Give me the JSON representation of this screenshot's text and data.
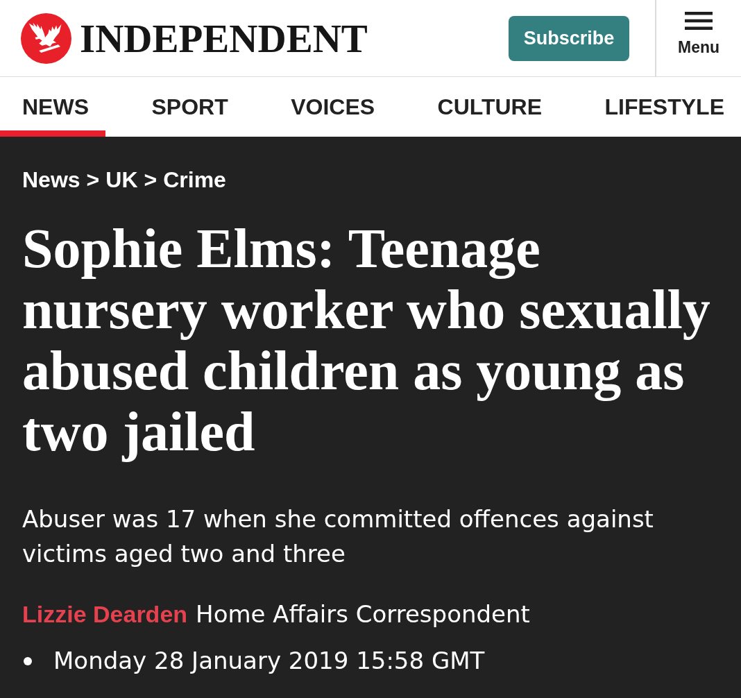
{
  "header": {
    "logo": {
      "wordmark": "INDEPENDENT"
    },
    "subscribe_button": "Subscribe",
    "menu_button": "Menu"
  },
  "nav": {
    "tabs": [
      {
        "label": "NEWS",
        "selected": true
      },
      {
        "label": "SPORT",
        "selected": false
      },
      {
        "label": "VOICES",
        "selected": false
      },
      {
        "label": "CULTURE",
        "selected": false
      },
      {
        "label": "LIFESTYLE",
        "selected": false
      }
    ]
  },
  "article": {
    "breadcrumb": [
      {
        "label": "News"
      },
      {
        "separator": ">",
        "label": "UK"
      },
      {
        "separator": ">",
        "label": "Crime"
      }
    ],
    "headline": "Sophie Elms: Teenage nursery worker who sexually abused children as young as two jailed",
    "standfirst": "Abuser was 17 when she committed offences against victims aged two and three",
    "byline": {
      "author": "Lizzie Dearden",
      "role": "Home Affairs Correspondent"
    },
    "date": "Monday 28 January 2019 15:58 GMT"
  }
}
